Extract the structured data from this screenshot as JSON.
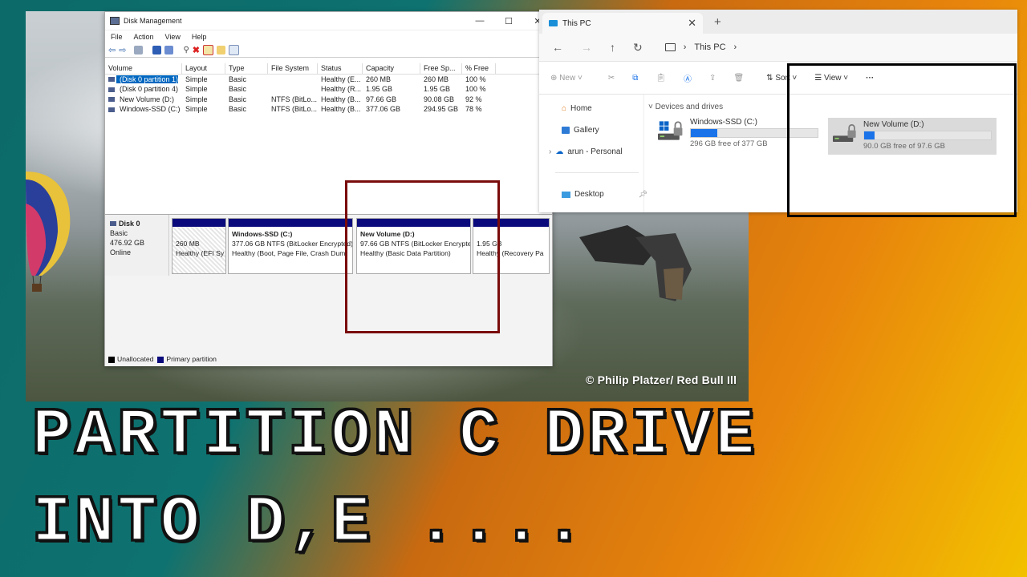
{
  "photo": {
    "credit": "© Philip Platzer/ Red Bull Ill"
  },
  "disk_management": {
    "title": "Disk Management",
    "menu": [
      "File",
      "Action",
      "View",
      "Help"
    ],
    "columns": [
      "Volume",
      "Layout",
      "Type",
      "File System",
      "Status",
      "Capacity",
      "Free Sp...",
      "% Free"
    ],
    "rows": [
      [
        "(Disk 0 partition 1)",
        "Simple",
        "Basic",
        "",
        "Healthy (E...",
        "260 MB",
        "260 MB",
        "100 %"
      ],
      [
        "(Disk 0 partition 4)",
        "Simple",
        "Basic",
        "",
        "Healthy (R...",
        "1.95 GB",
        "1.95 GB",
        "100 %"
      ],
      [
        "New Volume (D:)",
        "Simple",
        "Basic",
        "NTFS (BitLo...",
        "Healthy (B...",
        "97.66 GB",
        "90.08 GB",
        "92 %"
      ],
      [
        "Windows-SSD (C:)",
        "Simple",
        "Basic",
        "NTFS (BitLo...",
        "Healthy (B...",
        "377.06 GB",
        "294.95 GB",
        "78 %"
      ]
    ],
    "disk": {
      "name": "Disk 0",
      "type": "Basic",
      "size": "476.92 GB",
      "status": "Online"
    },
    "partitions": [
      {
        "title": "",
        "line1": "260 MB",
        "line2": "Healthy (EFI Sy"
      },
      {
        "title": "Windows-SSD (C:)",
        "line1": "377.06 GB NTFS (BitLocker Encrypted)",
        "line2": "Healthy (Boot, Page File, Crash Dum"
      },
      {
        "title": "New Volume (D:)",
        "line1": "97.66 GB NTFS (BitLocker Encrypte",
        "line2": "Healthy (Basic Data Partition)"
      },
      {
        "title": "",
        "line1": "1.95 GB",
        "line2": "Healthy (Recovery Pa"
      }
    ],
    "legend": {
      "unallocated": "Unallocated",
      "primary": "Primary partition",
      "unallocated_color": "#000000",
      "primary_color": "#0a0a7c"
    }
  },
  "explorer": {
    "tab_title": "This PC",
    "address": "This PC",
    "commands": {
      "new": "New",
      "sort": "Sort",
      "view": "View",
      "more": "···"
    },
    "sidebar": {
      "home": "Home",
      "gallery": "Gallery",
      "onedrive": "arun - Personal",
      "desktop": "Desktop"
    },
    "section_header": "Devices and drives",
    "drives": [
      {
        "name": "Windows-SSD (C:)",
        "free": "296 GB free of 377 GB",
        "used_fraction": 0.21
      },
      {
        "name": "New Volume (D:)",
        "free": "90.0 GB free of 97.6 GB",
        "used_fraction": 0.08
      }
    ]
  },
  "headline": {
    "line1": "PARTITION C DRIVE",
    "line2": "INTO D,E ...."
  }
}
